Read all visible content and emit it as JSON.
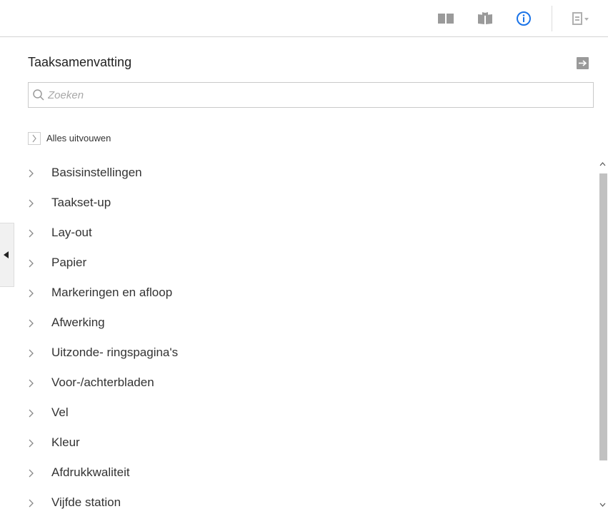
{
  "toolbar": {
    "icons": [
      "two-page-view-icon",
      "book-view-icon",
      "info-icon",
      "document-menu-icon"
    ],
    "active_color": "#1a73e8",
    "icon_color": "#9a9a9a"
  },
  "panel": {
    "title": "Taaksamenvatting",
    "search_placeholder": "Zoeken",
    "expand_all_label": "Alles uitvouwen"
  },
  "items": [
    {
      "label": "Basisinstellingen"
    },
    {
      "label": "Taakset-up"
    },
    {
      "label": "Lay-out"
    },
    {
      "label": "Papier"
    },
    {
      "label": "Markeringen en afloop"
    },
    {
      "label": "Afwerking"
    },
    {
      "label": "Uitzonde- ringspagina's"
    },
    {
      "label": "Voor-/achterbladen"
    },
    {
      "label": "Vel"
    },
    {
      "label": "Kleur"
    },
    {
      "label": "Afdrukkwaliteit"
    },
    {
      "label": "Vijfde station"
    }
  ]
}
